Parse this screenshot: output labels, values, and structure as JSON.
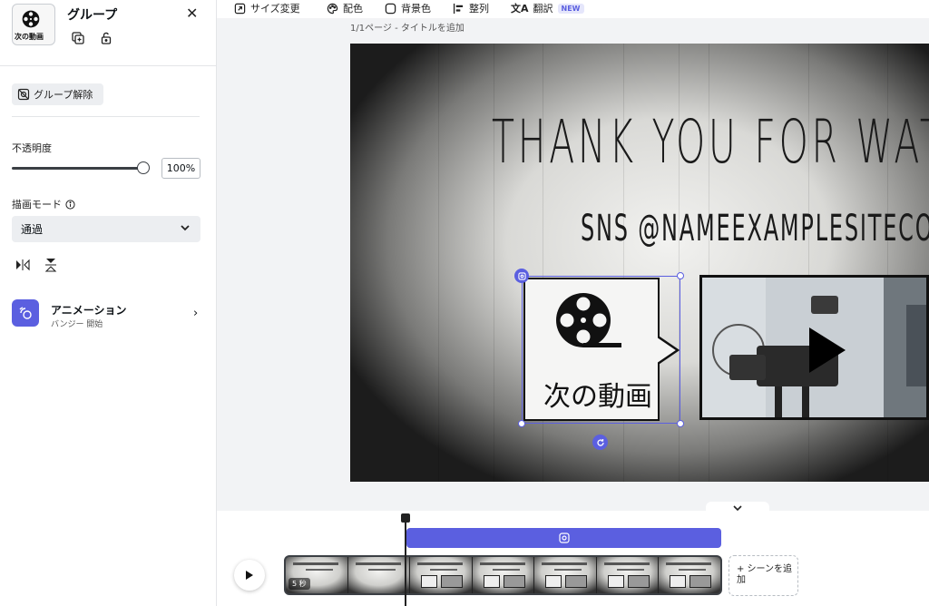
{
  "panel": {
    "title": "グループ",
    "thumb_label": "次の動画",
    "ungroup_label": "グループ解除",
    "opacity_label": "不透明度",
    "opacity_value": "100%",
    "opacity_level": 1.0,
    "blend_label": "描画モード",
    "blend_value": "通過",
    "animation_title": "アニメーション",
    "animation_sub": "バンジー 開始"
  },
  "toolbar": {
    "resize": "サイズ変更",
    "colors": "配色",
    "bg_color": "背景色",
    "align": "整列",
    "translate": "翻訳",
    "new_badge": "NEW"
  },
  "page_label": "1/1ページ - タイトルを追加",
  "canvas": {
    "title": "THANK YOU FOR WATCHING",
    "sns": "SNS @NAMEEXAMPLESITECOM",
    "bubble_text": "次の動画"
  },
  "timeline": {
    "duration_badge": "5 秒",
    "add_scene": "+ シーンを追加"
  },
  "colors": {
    "accent": "#5b5fe0"
  }
}
